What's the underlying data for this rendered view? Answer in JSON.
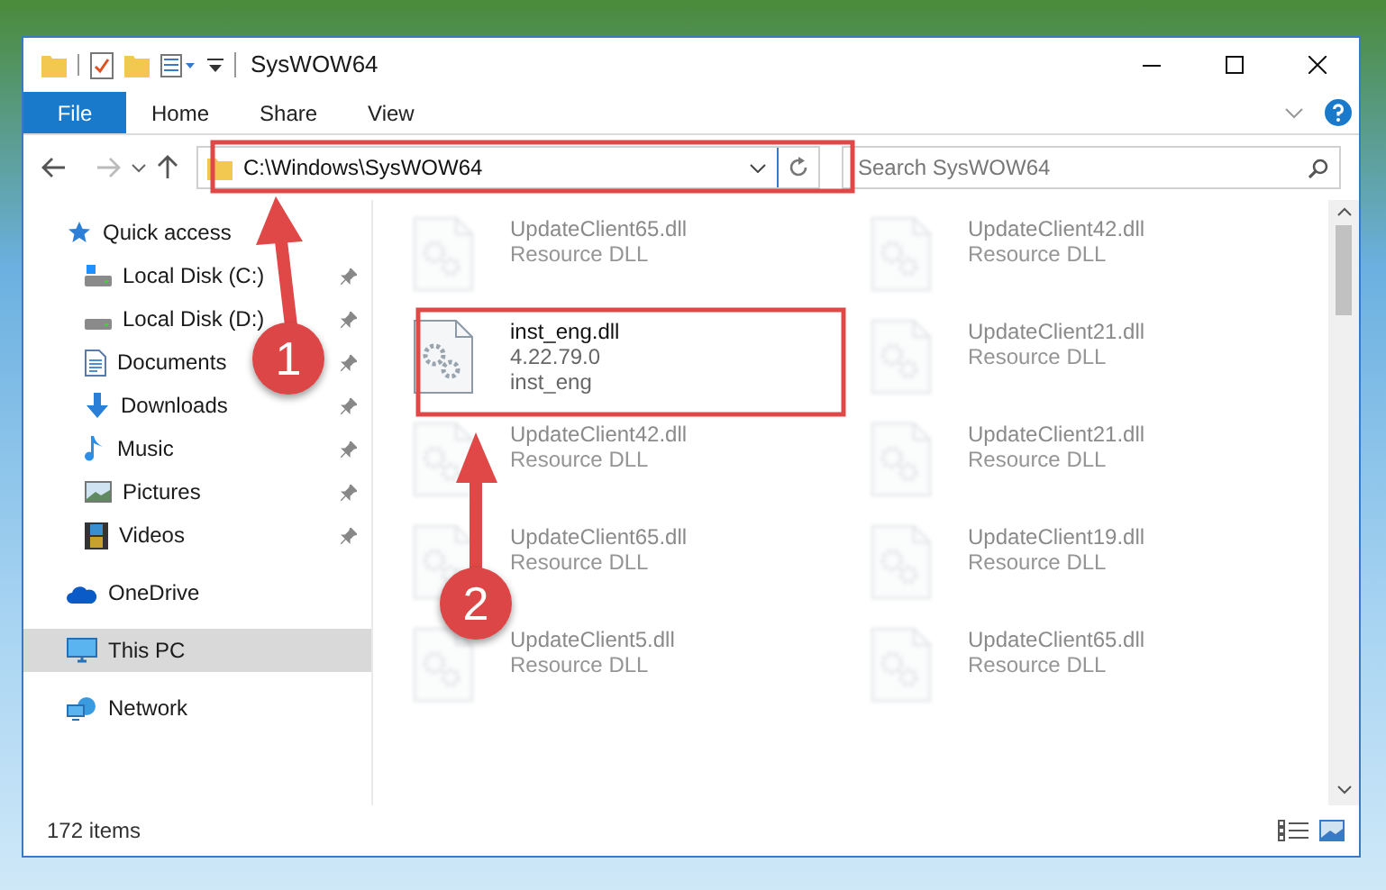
{
  "window": {
    "title": "SysWOW64"
  },
  "ribbon": {
    "file_tab": "File",
    "tabs": [
      "Home",
      "Share",
      "View"
    ]
  },
  "address": {
    "path": "C:\\Windows\\SysWOW64"
  },
  "search": {
    "placeholder": "Search SysWOW64"
  },
  "nav": [
    {
      "label": "Quick access",
      "kind": "quick",
      "selected": false,
      "children": [
        {
          "label": "Local Disk (C:)",
          "kind": "drive-c",
          "pinned": true
        },
        {
          "label": "Local Disk (D:)",
          "kind": "drive",
          "pinned": true
        },
        {
          "label": "Documents",
          "kind": "documents",
          "pinned": true
        },
        {
          "label": "Downloads",
          "kind": "downloads",
          "pinned": true
        },
        {
          "label": "Music",
          "kind": "music",
          "pinned": true
        },
        {
          "label": "Pictures",
          "kind": "pictures",
          "pinned": true
        },
        {
          "label": "Videos",
          "kind": "videos",
          "pinned": true
        }
      ]
    },
    {
      "label": "OneDrive",
      "kind": "onedrive",
      "selected": false
    },
    {
      "label": "This PC",
      "kind": "pc",
      "selected": true
    },
    {
      "label": "Network",
      "kind": "network",
      "selected": false
    }
  ],
  "files": [
    {
      "name": "UpdateClient65.dll",
      "lines": [
        "Resource DLL"
      ],
      "blurred": true
    },
    {
      "name": "UpdateClient42.dll",
      "lines": [
        "Resource DLL"
      ],
      "blurred": true
    },
    {
      "name": "inst_eng.dll",
      "lines": [
        "4.22.79.0",
        "inst_eng"
      ],
      "blurred": false
    },
    {
      "name": "UpdateClient21.dll",
      "lines": [
        "Resource DLL"
      ],
      "blurred": true
    },
    {
      "name": "UpdateClient42.dll",
      "lines": [
        "Resource DLL"
      ],
      "blurred": true
    },
    {
      "name": "UpdateClient21.dll",
      "lines": [
        "Resource DLL"
      ],
      "blurred": true
    },
    {
      "name": "UpdateClient65.dll",
      "lines": [
        "Resource DLL"
      ],
      "blurred": true
    },
    {
      "name": "UpdateClient19.dll",
      "lines": [
        "Resource DLL"
      ],
      "blurred": true
    },
    {
      "name": "UpdateClient5.dll",
      "lines": [
        "Resource DLL"
      ],
      "blurred": true
    },
    {
      "name": "UpdateClient65.dll",
      "lines": [
        "Resource DLL"
      ],
      "blurred": true
    }
  ],
  "annotations": [
    {
      "label": "1"
    },
    {
      "label": "2"
    }
  ],
  "status_bar": {
    "count": "172 items"
  }
}
